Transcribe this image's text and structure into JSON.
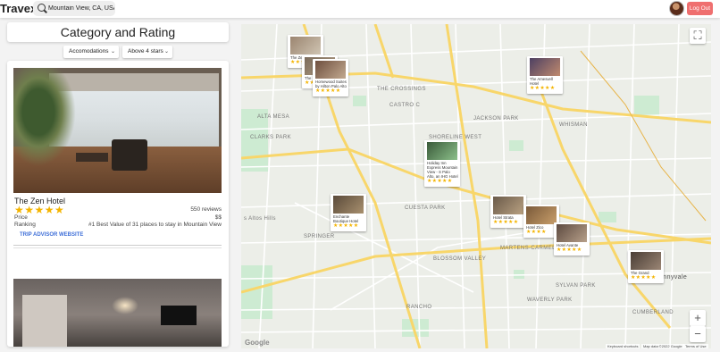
{
  "header": {
    "brand": "Travex",
    "search_value": "Mountain View, CA, USA",
    "logout_label": "Log Out"
  },
  "sidebar": {
    "title": "Category and Rating",
    "type_filter": "Accomodations",
    "rating_filter": "Above 4 stars"
  },
  "hotels": [
    {
      "name": "The Zen Hotel",
      "stars": "★★★★★",
      "rating": 5,
      "reviews": "550 reviews",
      "price_label": "Price",
      "price": "$$",
      "ranking_label": "Ranking",
      "ranking": "#1 Best Value of 31 places to stay in Mountain View",
      "link_tripadvisor": "TRIP ADVISOR",
      "link_website": "WEBSITE"
    }
  ],
  "map": {
    "labels": {
      "altamesa": "ALTA MESA",
      "crossings": "THE CROSSINGS",
      "castroc": "CASTRO C",
      "jackson": "JACKSON PARK",
      "whisman": "WHISMAN",
      "clarks": "CLARKS PARK",
      "shoreline": "SHORELINE WEST",
      "cuesta": "CUESTA PARK",
      "losaltos": "s Altos Hills",
      "springer": "SPRINGER",
      "martens": "MARTENS-CARMELITA",
      "blossom": "BLOSSOM VALLEY",
      "sylvan": "SYLVAN PARK",
      "waverly": "WAVERLY PARK",
      "rancho": "RANCHO",
      "cumberland": "CUMBERLAND",
      "sunnyvale": "unnyvale"
    },
    "google": "Google",
    "attr_shortcuts": "Keyboard shortcuts",
    "attr_data": "Map data ©2022 Google",
    "attr_terms": "Terms of Use",
    "pins": [
      {
        "name": "The Ze",
        "stars": "★★★"
      },
      {
        "name": "The\nMo",
        "stars": "★★"
      },
      {
        "name": "Homewood Suites by Hilton Palo Alto",
        "stars": "★★★★★"
      },
      {
        "name": "The Amesvell Hotel",
        "stars": "★★★★★"
      },
      {
        "name": "Holiday Inn Express Mountain View - S Palo Alto, an IHG Hotel",
        "stars": "★★★★★"
      },
      {
        "name": "Enchante Boutique Hotel",
        "stars": "★★★★★"
      },
      {
        "name": "Hotel Strata",
        "stars": "★★★★★"
      },
      {
        "name": "Hotel Zico",
        "stars": "★★★★"
      },
      {
        "name": "Hotel Avante",
        "stars": "★★★★★"
      },
      {
        "name": "The Grand",
        "stars": "★★★★★"
      }
    ]
  }
}
